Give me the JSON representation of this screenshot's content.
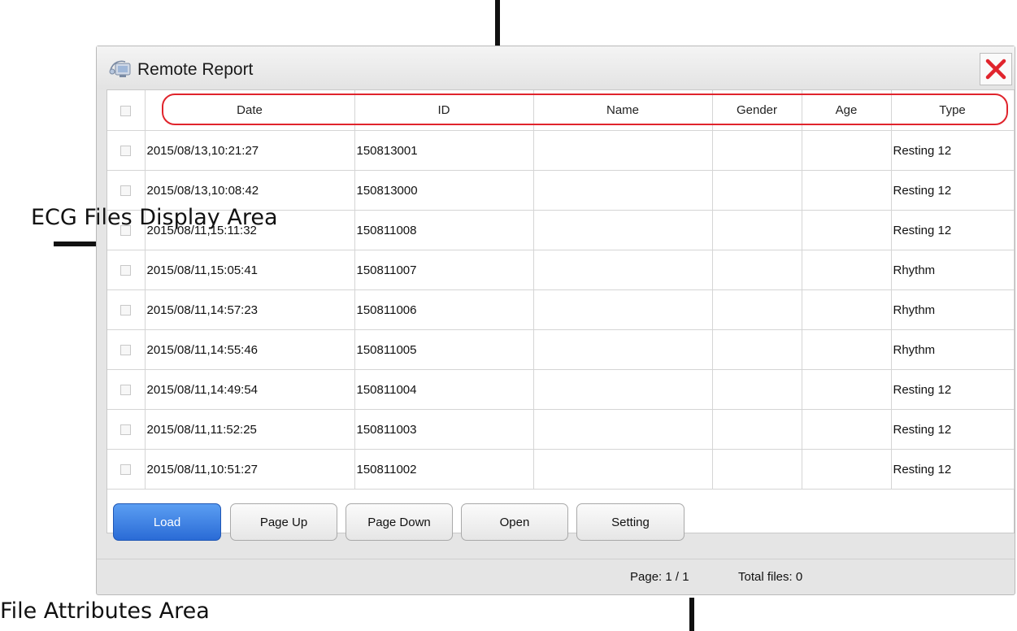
{
  "window": {
    "title": "Remote Report",
    "close_icon": "close-icon"
  },
  "table": {
    "columns": [
      "Date",
      "ID",
      "Name",
      "Gender",
      "Age",
      "Type"
    ],
    "rows": [
      {
        "date": "2015/08/13,10:21:27",
        "id": "150813001",
        "name": "",
        "gender": "",
        "age": "",
        "type": "Resting 12"
      },
      {
        "date": "2015/08/13,10:08:42",
        "id": "150813000",
        "name": "",
        "gender": "",
        "age": "",
        "type": "Resting 12"
      },
      {
        "date": "2015/08/11,15:11:32",
        "id": "150811008",
        "name": "",
        "gender": "",
        "age": "",
        "type": "Resting 12"
      },
      {
        "date": "2015/08/11,15:05:41",
        "id": "150811007",
        "name": "",
        "gender": "",
        "age": "",
        "type": "Rhythm"
      },
      {
        "date": "2015/08/11,14:57:23",
        "id": "150811006",
        "name": "",
        "gender": "",
        "age": "",
        "type": "Rhythm"
      },
      {
        "date": "2015/08/11,14:55:46",
        "id": "150811005",
        "name": "",
        "gender": "",
        "age": "",
        "type": "Rhythm"
      },
      {
        "date": "2015/08/11,14:49:54",
        "id": "150811004",
        "name": "",
        "gender": "",
        "age": "",
        "type": "Resting 12"
      },
      {
        "date": "2015/08/11,11:52:25",
        "id": "150811003",
        "name": "",
        "gender": "",
        "age": "",
        "type": "Resting 12"
      },
      {
        "date": "2015/08/11,10:51:27",
        "id": "150811002",
        "name": "",
        "gender": "",
        "age": "",
        "type": "Resting 12"
      }
    ]
  },
  "buttons": {
    "load": "Load",
    "page_up": "Page Up",
    "page_down": "Page Down",
    "open": "Open",
    "setting": "Setting"
  },
  "status": {
    "page": "Page: 1 / 1",
    "total": "Total files: 0"
  },
  "annotations": {
    "ecg_area": "ECG  Files Display Area",
    "file_attr": "File Attributes Area"
  },
  "colors": {
    "accent": "#2a6bd6",
    "highlight_outline": "#e0242c",
    "close_x": "#e0242c"
  }
}
